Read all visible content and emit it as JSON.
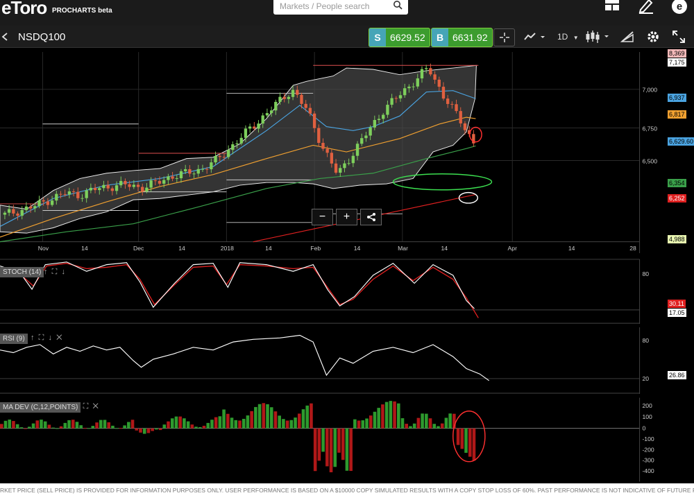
{
  "brand": {
    "logo": "eToro",
    "product": "PROCHARTS beta"
  },
  "search": {
    "placeholder": "Markets / People search"
  },
  "instrument": {
    "name": "NSDQ100"
  },
  "prices": {
    "sell_label": "S",
    "sell_value": "6629.52",
    "buy_label": "B",
    "buy_value": "6631.92"
  },
  "toolbar": {
    "timeframe": "1D"
  },
  "main_axis": {
    "y_ticks": [
      "7,000",
      "6,750",
      "6,500"
    ],
    "x_ticks": [
      "Nov",
      "14",
      "Dec",
      "14",
      "2018",
      "14",
      "Feb",
      "14",
      "Mar",
      "14",
      "Apr",
      "14",
      "28"
    ],
    "tags": [
      {
        "text": "8,369",
        "color": "#f2b8b8"
      },
      {
        "text": "7,175",
        "color": "#ffffff"
      },
      {
        "text": "6,937",
        "color": "#4aa3e0"
      },
      {
        "text": "6,817",
        "color": "#f0a030"
      },
      {
        "text": "6,629.60",
        "color": "#4aa3e0"
      },
      {
        "text": "6,354",
        "color": "#3aa04a"
      },
      {
        "text": "6,252",
        "color": "#e02020"
      },
      {
        "text": "4,988",
        "color": "#e8f5b0"
      }
    ]
  },
  "zoom": {
    "minus": "−",
    "plus": "+"
  },
  "stoch": {
    "label": "STOCH (14)",
    "y_ticks": [
      "80"
    ],
    "tag_k": "30.11",
    "tag_d": "17.05"
  },
  "rsi": {
    "label": "RSI (9)",
    "y_ticks": [
      "80",
      "20"
    ],
    "tag": "26.86"
  },
  "madev": {
    "label": "MA DEV (C,12,POINTS)",
    "y_ticks": [
      "200",
      "100",
      "0",
      "-100",
      "-200",
      "-300",
      "-400"
    ]
  },
  "footer": {
    "disclaimer": "RKET PRICE (SELL PRICE) IS PROVIDED FOR INFORMATION PURPOSES ONLY. USER PERFORMANCE IS BASED ON A $10000 COPY SIMULATED RESULTS WITH A COPY STOP LOSS OF 60%. PAST PERFORMANCE IS NOT INDICATIVE OF FUTURE RESULTS."
  },
  "colors": {
    "bullish": "#7ecf5c",
    "bearish": "#e06040",
    "accent": "#3c9c2e"
  },
  "chart_data": {
    "type": "candlestick",
    "series": [
      {
        "name": "NSDQ100",
        "ohlc_close_approx": [
          6120,
          6150,
          6180,
          6230,
          6270,
          6260,
          6300,
          6320,
          6330,
          6310,
          6340,
          6390,
          6410,
          6440,
          6500,
          6600,
          6700,
          6800,
          6900,
          7000,
          6850,
          6600,
          6400,
          6550,
          6700,
          6850,
          6950,
          7050,
          7150,
          6960,
          6800,
          6630
        ]
      }
    ]
  }
}
